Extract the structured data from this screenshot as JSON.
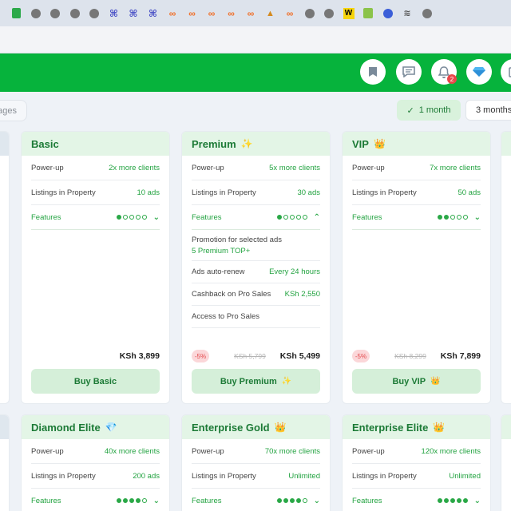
{
  "browser": {
    "favicons": [
      "evernote-icon",
      "globe-icon",
      "globe-icon",
      "globe-icon",
      "globe-icon",
      "hx-icon",
      "hx-icon",
      "hx-icon",
      "link-icon",
      "link-icon",
      "link-icon",
      "link-icon",
      "link-icon",
      "tent-icon",
      "link-icon",
      "globe-icon",
      "globe-icon",
      "w-icon",
      "shop-icon",
      "blue-circle-icon",
      "wifi-icon",
      "globe-icon"
    ]
  },
  "header": {
    "buttons": [
      "bookmark-icon",
      "chat-icon",
      "bell-icon",
      "diamond-icon",
      "clipboard-icon"
    ],
    "notification_count": "2"
  },
  "filters": {
    "left_pill": "ages",
    "period_active": "1 month",
    "period_other": "3 months"
  },
  "colors": {
    "brand": "#06b33c",
    "accent_text": "#23a341",
    "card_head": "#e3f5e6",
    "discount": "#e34a4e"
  },
  "cards": [
    {
      "title": "Basic",
      "emoji": "",
      "powerup_label": "Power-up",
      "powerup_value": "2x more clients",
      "listings_label": "Listings in Property",
      "listings_value": "10 ads",
      "features_label": "Features",
      "level": 1,
      "price": "KSh 3,899",
      "buy_label": "Buy Basic"
    },
    {
      "title": "Premium",
      "emoji": "✨",
      "powerup_label": "Power-up",
      "powerup_value": "5x more clients",
      "listings_label": "Listings in Property",
      "listings_value": "30 ads",
      "features_label": "Features",
      "level": 1,
      "perks": {
        "promo_label": "Promotion for selected ads",
        "promo_value": "5 Premium TOP+",
        "renew_label": "Ads auto-renew",
        "renew_value": "Every 24 hours",
        "cashback_label": "Cashback on Pro Sales",
        "cashback_value": "KSh 2,550",
        "access_label": "Access to Pro Sales"
      },
      "discount": "-5%",
      "old_price": "KSh 5,799",
      "price": "KSh 5,499",
      "buy_label": "Buy Premium"
    },
    {
      "title": "VIP",
      "emoji": "👑",
      "powerup_label": "Power-up",
      "powerup_value": "7x more clients",
      "listings_label": "Listings in Property",
      "listings_value": "50 ads",
      "features_label": "Features",
      "level": 2,
      "discount": "-5%",
      "old_price": "KSh 8,299",
      "price": "KSh 7,899",
      "buy_label": "Buy VIP"
    },
    {
      "title": "Diamond Elite",
      "emoji": "💎",
      "powerup_label": "Power-up",
      "powerup_value": "40x more clients",
      "listings_label": "Listings in Property",
      "listings_value": "200 ads",
      "features_label": "Features",
      "level": 4
    },
    {
      "title": "Enterprise Gold",
      "emoji": "👑",
      "powerup_label": "Power-up",
      "powerup_value": "70x more clients",
      "listings_label": "Listings in Property",
      "listings_value": "Unlimited",
      "features_label": "Features",
      "level": 4
    },
    {
      "title": "Enterprise Elite",
      "emoji": "👑",
      "powerup_label": "Power-up",
      "powerup_value": "120x more clients",
      "listings_label": "Listings in Property",
      "listings_value": "Unlimited",
      "features_label": "Features",
      "level": 5
    }
  ]
}
